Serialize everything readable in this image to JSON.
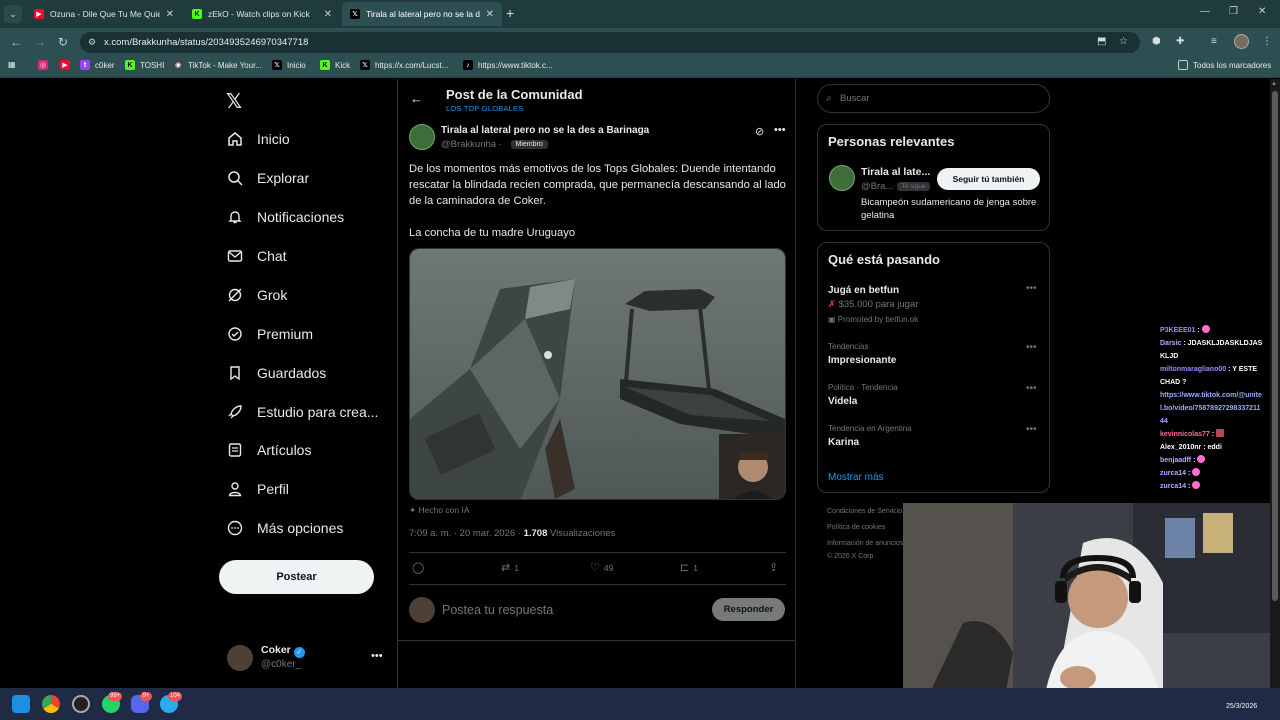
{
  "browser": {
    "tabs": [
      {
        "title": "Ozuna - Dile Que Tu Me Quieres",
        "active": false
      },
      {
        "title": "zEkO - Watch clips on Kick",
        "active": false
      },
      {
        "title": "Tirala al lateral pero no se la des",
        "active": true
      }
    ],
    "url": "x.com/Brakkunha/status/2034935246970347718",
    "bookmarks": [
      "c0ker",
      "TOSHI",
      "TikTok - Make Your...",
      "Inicio",
      "Kick",
      "https://x.com/Lucst...",
      "https://www.tiktok.c..."
    ],
    "all_bookmarks": "Todos los marcadores"
  },
  "sidebar": {
    "items": [
      {
        "label": "Inicio",
        "icon": "home-icon"
      },
      {
        "label": "Explorar",
        "icon": "search-icon"
      },
      {
        "label": "Notificaciones",
        "icon": "bell-icon"
      },
      {
        "label": "Chat",
        "icon": "envelope-icon"
      },
      {
        "label": "Grok",
        "icon": "grok-icon"
      },
      {
        "label": "Premium",
        "icon": "verified-icon"
      },
      {
        "label": "Guardados",
        "icon": "bookmark-icon"
      },
      {
        "label": "Estudio para crea...",
        "icon": "rocket-icon"
      },
      {
        "label": "Artículos",
        "icon": "article-icon"
      },
      {
        "label": "Perfil",
        "icon": "person-icon"
      },
      {
        "label": "Más opciones",
        "icon": "more-circle-icon"
      }
    ],
    "post_button": "Postear",
    "account": {
      "name": "Coker",
      "handle": "@c0ker_"
    }
  },
  "header": {
    "title": "Post de la Comunidad",
    "community": "LOS TOP GLOBALES"
  },
  "tweet": {
    "author_name": "Tirala al lateral pero no se la des a Barinaga",
    "author_handle": "@Brakkunha",
    "handle_sep": "·",
    "member_badge": "Miembro",
    "paragraph1": "De los momentos más emotivos de los Tops Globales: Duende intentando rescatar la blindada recien comprada, que permanecía descansando al lado de la caminadora de Coker.",
    "paragraph2": "La concha de tu madre Uruguayo",
    "ai_label": "Hecho con IA",
    "timestamp": "7:09 a. m. · 20 mar. 2026 · ",
    "views_count": "1.708",
    "views_label": " Visualizaciones",
    "retweets": "1",
    "likes": "49",
    "bookmarks": "1"
  },
  "reply": {
    "placeholder": "Postea tu respuesta",
    "button": "Responder"
  },
  "right": {
    "search_placeholder": "Buscar",
    "relevant_title": "Personas relevantes",
    "relevant_name": "Tirala al late...",
    "relevant_handle": "@Bra...",
    "follows_you": "Te sigue",
    "follow_button": "Seguir tú también",
    "relevant_bio": "Bicampeón sudamericano de jenga sobre gelatina",
    "trends_title": "Qué está pasando",
    "promo_name": "Jugá en betfun",
    "promo_sub": "$35.000 para jugar",
    "promo_by": "Promoted by betfun.ok",
    "trends": [
      {
        "context": "Tendencias",
        "name": "Impresionante"
      },
      {
        "context": "Política · Tendencia",
        "name": "Videla"
      },
      {
        "context": "Tendencia en Argentina",
        "name": "Karina"
      }
    ],
    "show_more": "Mostrar más",
    "footer": [
      "Condiciones de Servicio",
      "Política de cookies",
      "Información de anuncios",
      "© 2026 X Corp."
    ]
  },
  "chat": [
    {
      "user": "P3KEEE01",
      "msg": ""
    },
    {
      "user": "Darsic",
      "msg": "JDASKLJDASKLDJASKLJD"
    },
    {
      "user": "miltonmaragliano00",
      "msg": "Y ESTE CHAD ?"
    },
    {
      "user": "",
      "msg": "https://www.tiktok.com/@unitel.bo/video/7587892729833721144"
    },
    {
      "user": "kevinnicolas77",
      "msg": ""
    },
    {
      "user": "Alex_2010nr",
      "msg": "eddi"
    },
    {
      "user": "benjaadff",
      "msg": ""
    },
    {
      "user": "zurca14",
      "msg": ""
    },
    {
      "user": "zurca14",
      "msg": ""
    }
  ],
  "taskbar": {
    "badge_whatsapp": "99+",
    "badge_discord": "9+",
    "badge_telegram": "104",
    "date": "25/3/2026"
  }
}
